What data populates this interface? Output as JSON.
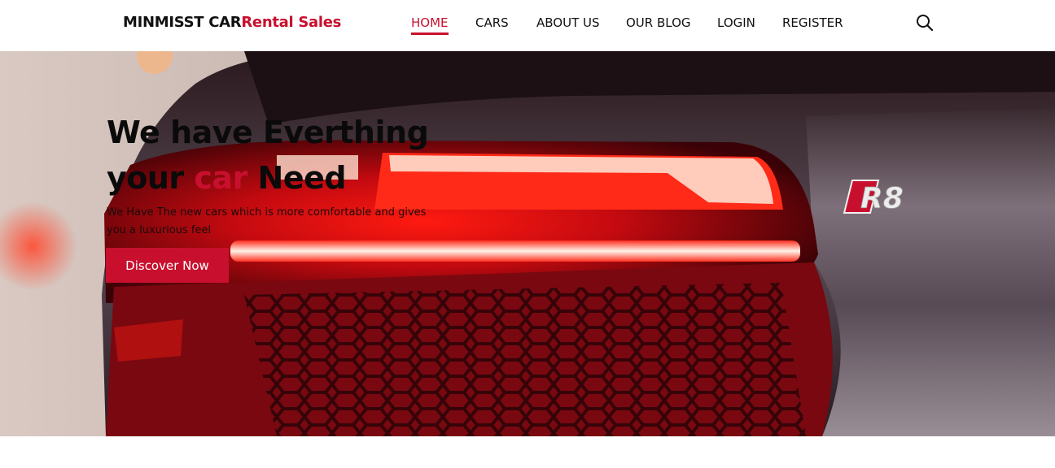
{
  "brand": {
    "name_part1": "MINMISST CAR",
    "name_part2": "Rental Sales",
    "accent_color": "#c8102e"
  },
  "nav": {
    "items": [
      {
        "label": "HOME",
        "active": true
      },
      {
        "label": "CARS",
        "active": false
      },
      {
        "label": "ABOUT US",
        "active": false
      },
      {
        "label": "OUR BLOG",
        "active": false
      },
      {
        "label": "LOGIN",
        "active": false
      },
      {
        "label": "REGISTER",
        "active": false
      }
    ],
    "search_icon": "search-icon"
  },
  "hero": {
    "title_line1": "We have Everthing",
    "title_line2_pre": "your ",
    "title_line2_accent": "car",
    "title_line2_post": " Need",
    "subtitle": "We Have The new cars which is more comfortable and gives you a luxurious feel",
    "cta_label": "Discover Now",
    "badge_text": "R8"
  }
}
